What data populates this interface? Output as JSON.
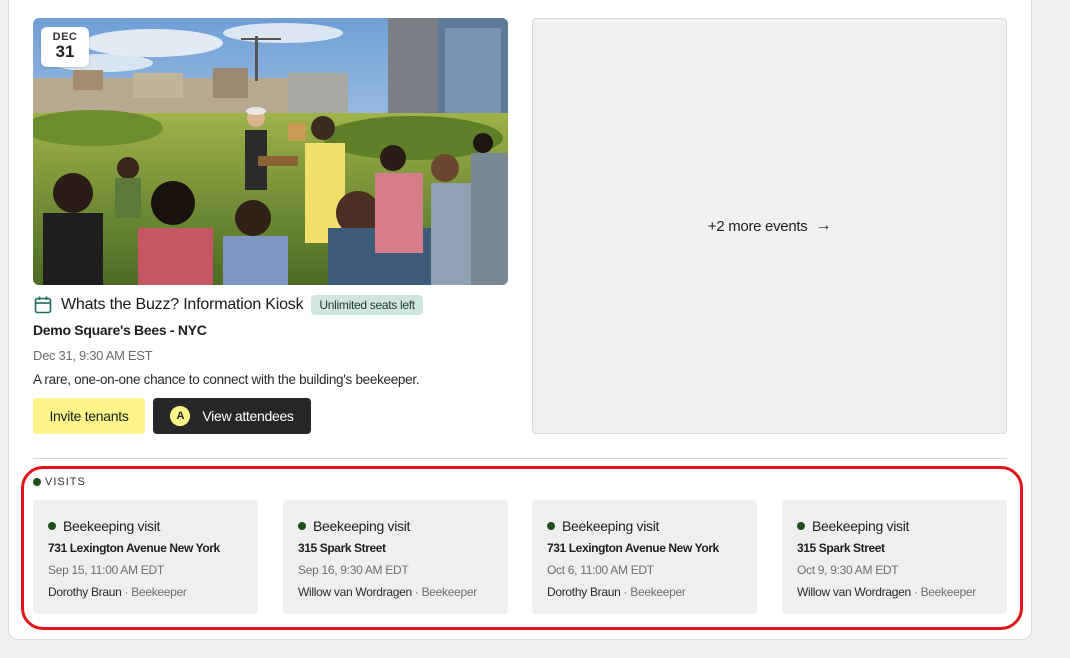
{
  "event": {
    "date_month": "DEC",
    "date_day": "31",
    "title": "Whats the Buzz? Information Kiosk",
    "seats_badge": "Unlimited seats left",
    "organization": "Demo Square's Bees - NYC",
    "time": "Dec 31, 9:30 AM EST",
    "description": "A rare, one-on-one chance to connect with the building's beekeeper.",
    "invite_label": "Invite tenants",
    "attendees_label": "View attendees",
    "avatar_initial": "A",
    "image_icon": "rooftop-garden-photo",
    "calendar_icon": "calendar-icon"
  },
  "more_events": {
    "label": "+2 more events",
    "arrow": "→"
  },
  "visits": {
    "heading": "VISITS",
    "items": [
      {
        "title": "Beekeeping visit",
        "address": "731 Lexington Avenue New York",
        "time": "Sep 15, 11:00 AM EDT",
        "host": "Dorothy Braun",
        "role": "· Beekeeper"
      },
      {
        "title": "Beekeeping visit",
        "address": "315 Spark Street",
        "time": "Sep 16, 9:30 AM EDT",
        "host": "Willow van Wordragen",
        "role": "· Beekeeper"
      },
      {
        "title": "Beekeeping visit",
        "address": "731 Lexington Avenue New York",
        "time": "Oct 6, 11:00 AM EDT",
        "host": "Dorothy Braun",
        "role": "· Beekeeper"
      },
      {
        "title": "Beekeeping visit",
        "address": "315 Spark Street",
        "time": "Oct 9, 9:30 AM EDT",
        "host": "Willow van Wordragen",
        "role": "· Beekeeper"
      }
    ]
  },
  "colors": {
    "accent_yellow": "#fbf58a",
    "dark_button": "#262626",
    "badge_teal": "#cfe6e0",
    "status_dot": "#1f4d1c",
    "highlight_red": "#e3121b"
  }
}
